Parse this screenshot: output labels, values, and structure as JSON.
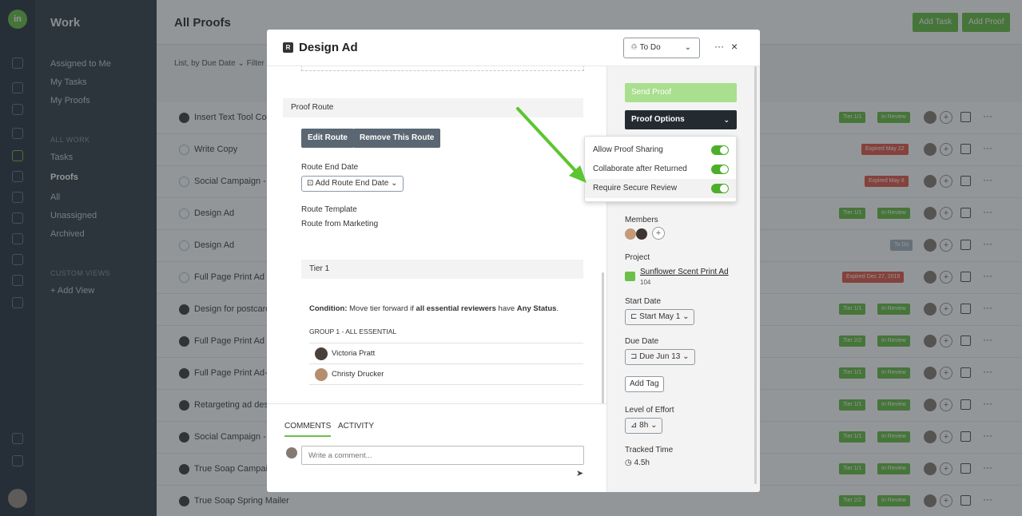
{
  "app": {
    "logo": "in",
    "nav_title": "Work",
    "nav_items": [
      "Assigned to Me",
      "My Tasks",
      "My Proofs"
    ],
    "all_work_head": "ALL WORK",
    "all_work_items": [
      "Tasks",
      "Proofs",
      "All",
      "Unassigned",
      "Archived"
    ],
    "custom_head": "CUSTOM VIEWS",
    "add_view": "+ Add View"
  },
  "main": {
    "title": "All Proofs",
    "add_task": "Add Task",
    "add_proof": "Add Proof",
    "filter": "List, by Due Date ⌄  Filter",
    "rows": [
      {
        "name": "Insert Text Tool Copy f",
        "light": false,
        "badges": [
          "Tier 1/1",
          "In Review"
        ]
      },
      {
        "name": "Write Copy",
        "light": true,
        "badges": [
          "Expired May 22"
        ]
      },
      {
        "name": "Social Campaign - Sun",
        "light": true,
        "badges": [
          "Expired May 8"
        ]
      },
      {
        "name": "Design Ad",
        "light": true,
        "badges": [
          "Tier 1/1",
          "In Review"
        ]
      },
      {
        "name": "Design Ad",
        "light": true,
        "badges": [
          "To Do"
        ]
      },
      {
        "name": "Full Page Print Ad",
        "light": true,
        "badges": [
          "Expired Dec 27, 2019"
        ]
      },
      {
        "name": "Design for postcard m",
        "light": false,
        "badges": [
          "Tier 1/1",
          "In Review"
        ]
      },
      {
        "name": "Full Page Print Ad",
        "light": false,
        "badges": [
          "Tier 2/2",
          "In Review"
        ]
      },
      {
        "name": "Full Page Print Ad- Spr",
        "light": false,
        "badges": [
          "Tier 1/1",
          "In Review"
        ]
      },
      {
        "name": "Retargeting ad design",
        "light": false,
        "badges": [
          "Tier 1/1",
          "In Review"
        ]
      },
      {
        "name": "Social Campaign - Sun",
        "light": false,
        "badges": [
          "Tier 1/1",
          "In Review"
        ]
      },
      {
        "name": "True Soap Campaign",
        "light": false,
        "badges": [
          "Tier 1/1",
          "In Review"
        ]
      },
      {
        "name": "True Soap Spring Mailer",
        "light": false,
        "badges": [
          "Tier 2/2",
          "In Review"
        ]
      }
    ]
  },
  "modal": {
    "title": "Design Ad",
    "status": "To Do",
    "more": "···",
    "close": "×",
    "proof_route": "Proof Route",
    "edit_route": "Edit Route",
    "remove_route": "Remove This Route",
    "route_end_label": "Route End Date",
    "add_route_end": "Add Route End Date",
    "route_template_label": "Route Template",
    "route_template": "Route from Marketing",
    "tier": "Tier 1",
    "condition_prefix": "Condition:",
    "condition_mid1": " Move tier forward if ",
    "condition_bold1": "all essential reviewers",
    "condition_mid2": " have ",
    "condition_bold2": "Any Status",
    "condition_end": ".",
    "group": "GROUP 1 - ALL ESSENTIAL",
    "reviewers": [
      "Victoria Pratt",
      "Christy Drucker"
    ],
    "comments_tab": "COMMENTS",
    "activity_tab": "ACTIVITY",
    "comment_placeholder": "Write a comment..."
  },
  "sidebar": {
    "send_proof": "Send Proof",
    "proof_options": "Proof Options",
    "members_label": "Members",
    "project_label": "Project",
    "project_name": "Sunflower Scent Print Ad",
    "project_number": "104",
    "start_label": "Start Date",
    "start_value": "Start May 1",
    "due_label": "Due Date",
    "due_value": "Due Jun 13",
    "add_tag": "Add Tag",
    "effort_label": "Level of Effort",
    "effort_value": "8h",
    "tracked_label": "Tracked Time",
    "tracked_value": "4.5h"
  },
  "dropdown": {
    "options": [
      {
        "label": "Allow Proof Sharing",
        "on": true
      },
      {
        "label": "Collaborate after Returned",
        "on": true
      },
      {
        "label": "Require Secure Review",
        "on": true
      }
    ]
  },
  "colors": {
    "accent_green": "#6cc04a",
    "toggle_on": "#4caf2a",
    "arrow": "#5cc530"
  }
}
